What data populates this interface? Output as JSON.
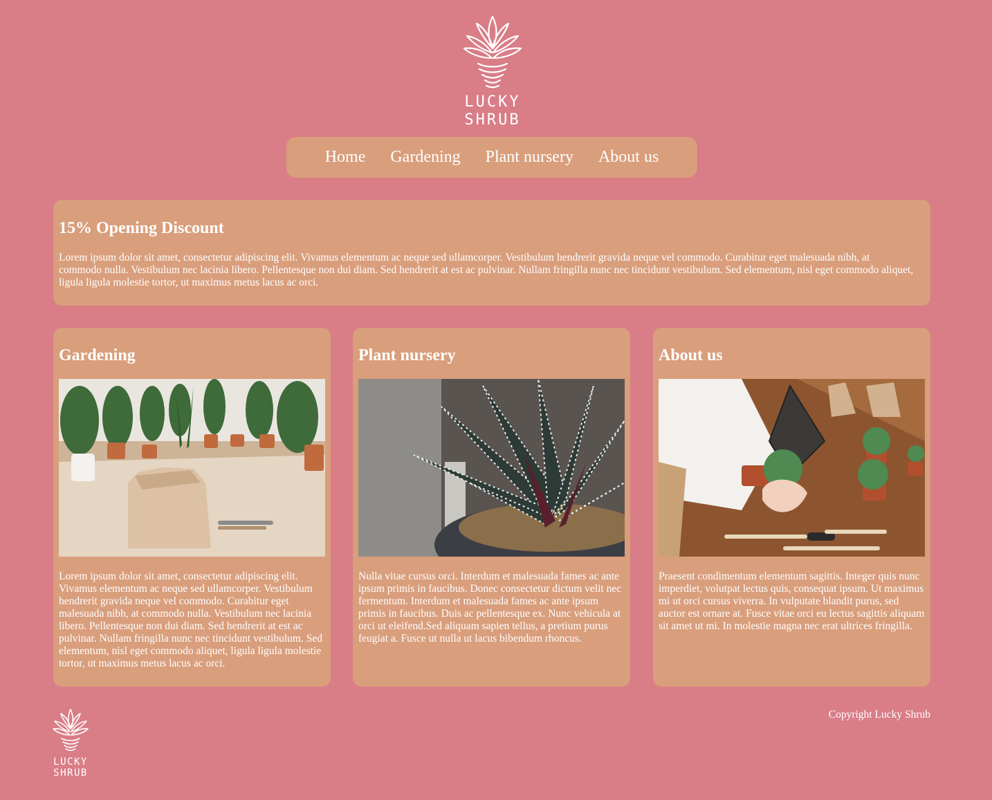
{
  "colors": {
    "page_background": "#d97d87",
    "card_background": "#d99e7c",
    "text": "#ffffff"
  },
  "logo": {
    "icon": "succulent-logo-icon",
    "word1": "LUCKY",
    "word2": "SHRUB"
  },
  "nav": {
    "items": [
      {
        "label": "Home"
      },
      {
        "label": "Gardening"
      },
      {
        "label": "Plant nursery"
      },
      {
        "label": "About us"
      }
    ]
  },
  "promo": {
    "title": "15% Opening Discount",
    "body": "Lorem ipsum dolor sit amet, consectetur adipiscing elit. Vivamus elementum ac neque sed ullamcorper. Vestibulum hendrerit gravida neque vel commodo. Curabitur eget malesuada nibh, at commodo nulla. Vestibulum nec lacinia libero. Pellentesque non dui diam. Sed hendrerit at est ac pulvinar. Nullam fringilla nunc nec tincidunt vestibulum. Sed elementum, nisl eget commodo aliquet, ligula ligula molestie tortor, ut maximus metus lacus ac orci."
  },
  "columns": [
    {
      "title": "Gardening",
      "image": "paper-bag-with-potted-plants-photo",
      "body": "Lorem ipsum dolor sit amet, consectetur adipiscing elit. Vivamus elementum ac neque sed ullamcorper. Vestibulum hendrerit gravida neque vel commodo. Curabitur eget malesuada nibh, at commodo nulla. Vestibulum nec lacinia libero. Pellentesque non dui diam. Sed hendrerit at est ac pulvinar. Nullam fringilla nunc nec tincidunt vestibulum. Sed elementum, nisl eget commodo aliquet, ligula ligula molestie tortor, ut maximus metus lacus ac orci."
    },
    {
      "title": "Plant nursery",
      "image": "zebra-succulent-closeup-photo",
      "body": "Nulla vitae cursus orci. Interdum et malesuada fames ac ante ipsum primis in faucibus. Donec consectetur dictum velit nec fermentum. Interdum et malesuada fames ac ante ipsum primis in faucibus. Duis ac pellentesque ex. Nunc vehicula at orci ut eleifend.Sed aliquam sapien tellus, a pretium purus feugiat a. Fusce ut nulla ut lacus bibendum rhoncus."
    },
    {
      "title": "About us",
      "image": "hands-potting-succulents-photo",
      "body": "Praesent condimentum elementum sagittis. Integer quis nunc imperdiet, volutpat lectus quis, consequat ipsum. Ut maximus mi ut orci cursus viverra. In vulputate blandit purus, sed auctor est ornare at. Fusce vitae orci eu lectus sagittis aliquam sit amet ut mi. In molestie magna nec erat ultrices fringilla."
    }
  ],
  "footer": {
    "copyright": "Copyright Lucky Shrub"
  }
}
